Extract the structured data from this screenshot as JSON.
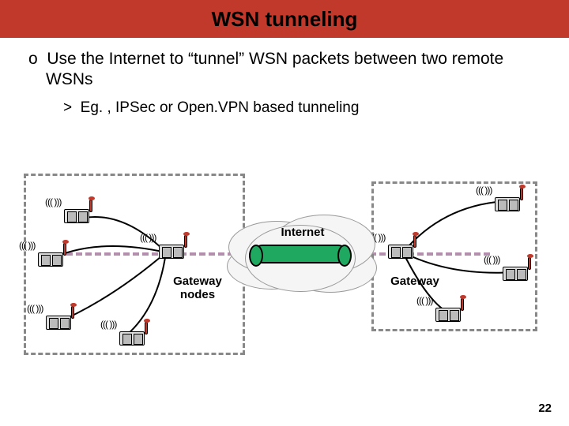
{
  "title": "WSN tunneling",
  "bullet_main": "Use the Internet to “tunnel” WSN packets between two remote WSNs",
  "bullet_sub": "Eg. , IPSec or Open.VPN based tunneling",
  "labels": {
    "internet": "Internet",
    "gateway_left": "Gateway nodes",
    "gateway_right": "Gateway"
  },
  "page_number": "22"
}
